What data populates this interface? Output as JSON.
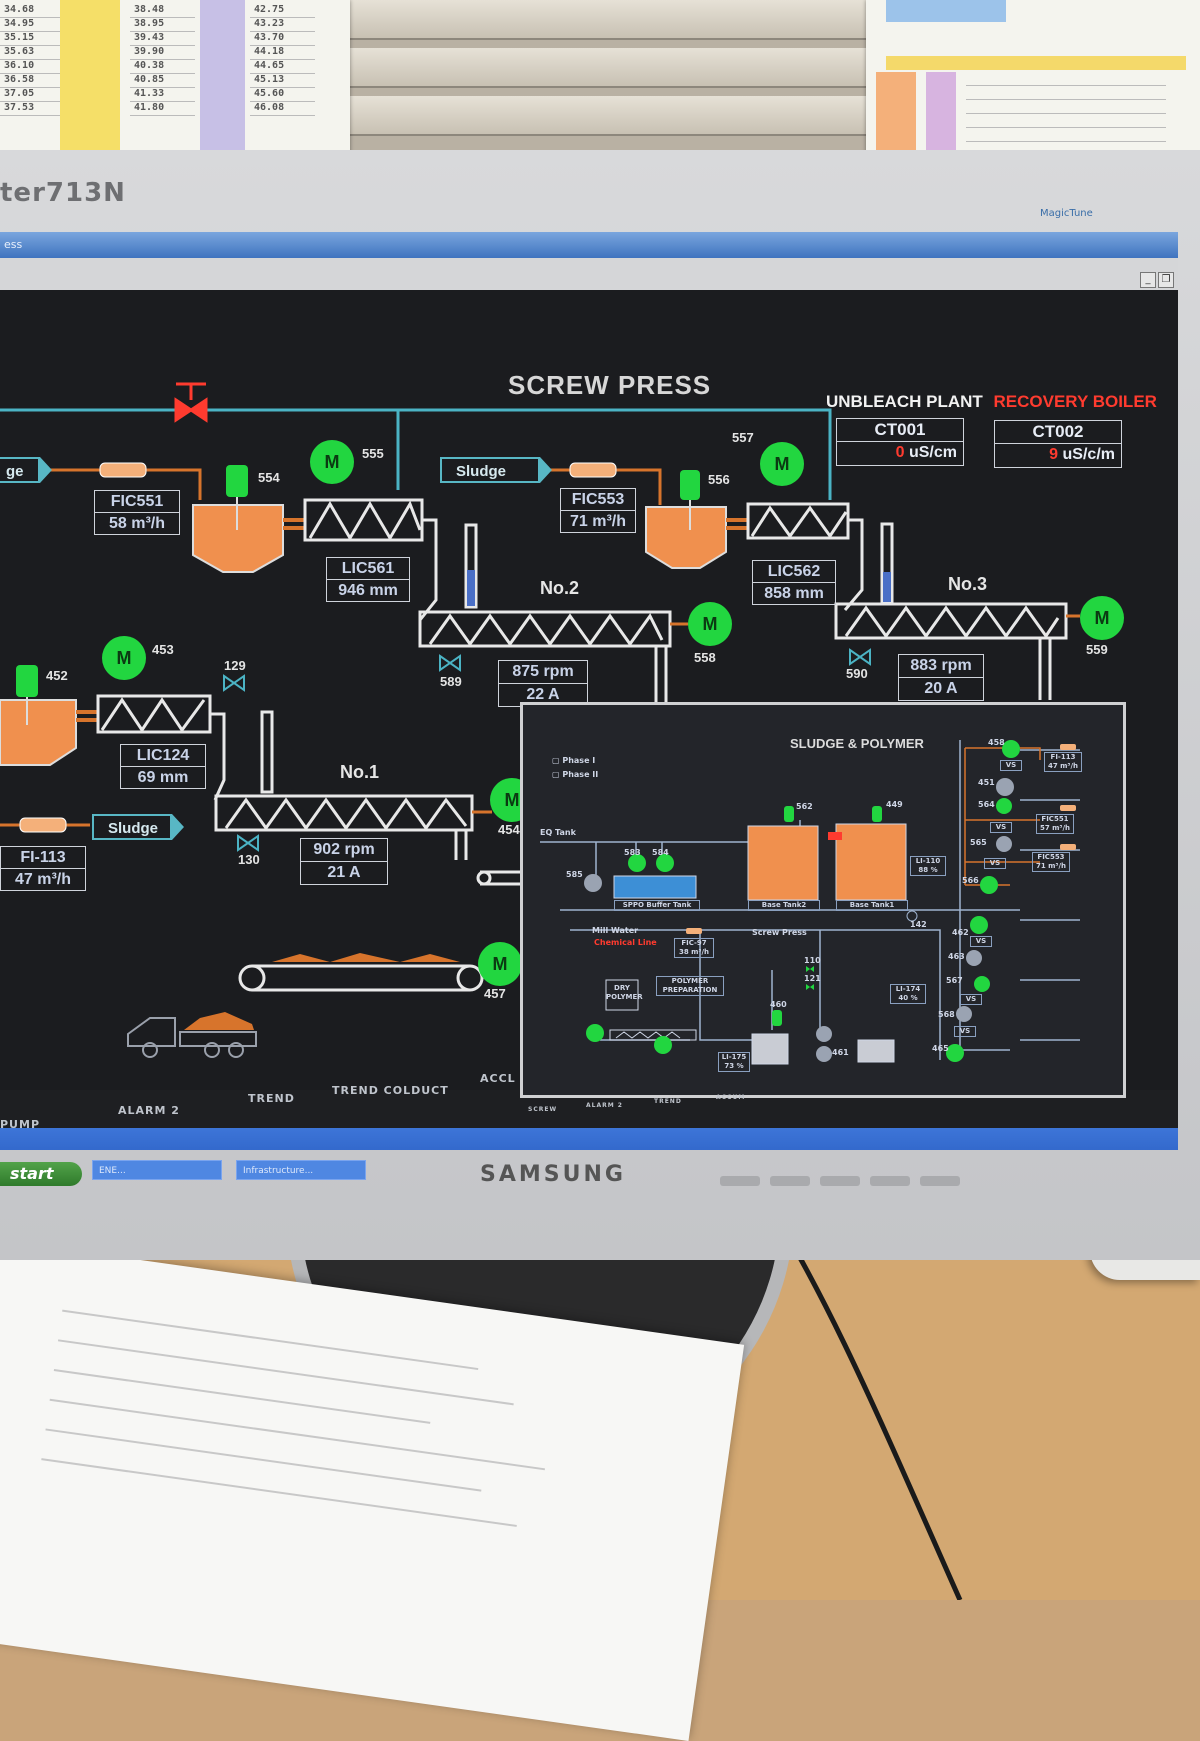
{
  "window": {
    "title": "ess"
  },
  "monitor": {
    "model": "ter713N",
    "brand": "SAMSUNG",
    "badge": "MagicTune"
  },
  "hmi": {
    "title": "SCREW PRESS",
    "legend": {
      "unbleach": "UNBLEACH PLANT",
      "recovery": "RECOVERY BOILER"
    },
    "conductivity": [
      {
        "tag": "CT001",
        "value": "0",
        "unit": "uS/cm"
      },
      {
        "tag": "CT002",
        "value": "9",
        "unit": "uS/c/m"
      }
    ],
    "line5": {
      "sludge_label": "ge",
      "fic": {
        "tag": "FIC551",
        "value": "58 m³/h"
      },
      "agitator": "554",
      "motor": "555",
      "lic": {
        "tag": "LIC561",
        "value": "946 mm"
      }
    },
    "press2": {
      "sludge_label": "Sludge",
      "fic": {
        "tag": "FIC553",
        "value": "71 m³/h"
      },
      "agitator": "556",
      "motor": "557",
      "name": "No.2",
      "press_motor": "558",
      "valve": "589",
      "speed": "875 rpm",
      "current": "22   A"
    },
    "press3": {
      "lic": {
        "tag": "LIC562",
        "value": "858 mm"
      },
      "name": "No.3",
      "press_motor": "559",
      "valve": "590",
      "speed": "883 rpm",
      "current": "20   A"
    },
    "press1": {
      "agitator": "452",
      "motor": "453",
      "valve": "129",
      "lic": {
        "tag": "LIC124",
        "value": "69 mm"
      },
      "name": "No.1",
      "press_motor": "454",
      "valve2": "130",
      "speed": "902 rpm",
      "current": "21   A",
      "sludge_label": "Sludge",
      "fi": {
        "tag": "FI-113",
        "value": "47 m³/h"
      },
      "conveyor_motor": "457"
    },
    "main_tabs": [
      "PUMP",
      "ALARM 2",
      "TREND",
      "TREND COLDUCT",
      "ACCL"
    ]
  },
  "inset": {
    "title": "SLUDGE & POLYMER",
    "phase_legend": [
      "Phase I",
      "Phase II"
    ],
    "labels": {
      "eq_tank": "EQ Tank",
      "buffer": "SPPO Buffer Tank",
      "tank2": "Base Tank2",
      "tank1": "Base Tank1",
      "mill_water": "Mill Water",
      "screw_press": "Screw Press",
      "polymer": "POLYMER PREPARATION",
      "dry_polymer": "DRY POLYMER",
      "fic97": "FIC-97",
      "fic97_val": "38 m³/h",
      "li110": "LI-110",
      "li110_val": "88 %",
      "li174": "LI-174",
      "li174_val": "40 %",
      "li175": "LI-175",
      "li175_val": "73 %",
      "fi113": "FI-113",
      "fi113_val": "47 m³/h",
      "fic551": "FIC551",
      "fic551_val": "57 m³/h",
      "fic553": "FIC553",
      "fic553_val": "71 m³/h",
      "vs": "VS",
      "chemical_line": "Chemical Line"
    },
    "numbers": [
      "585",
      "583",
      "584",
      "562",
      "449",
      "142",
      "110",
      "121",
      "460",
      "461",
      "451",
      "450",
      "564",
      "565",
      "566",
      "462",
      "463",
      "567",
      "568",
      "465",
      "458"
    ],
    "tabs": [
      "SCREW",
      "ALARM 2",
      "TREND",
      "ACCUM"
    ]
  },
  "taskbar": {
    "start": "start",
    "tasks": [
      "ENE...",
      "Infrastructure..."
    ]
  },
  "colors": {
    "motor_green": "#22d640",
    "tank_orange": "#f0904e",
    "pipe_teal": "#4bb3c4",
    "pipe_orange": "#d7742c",
    "alarm_red": "#ff3b2f",
    "screen_bg": "#1b1c1f"
  }
}
